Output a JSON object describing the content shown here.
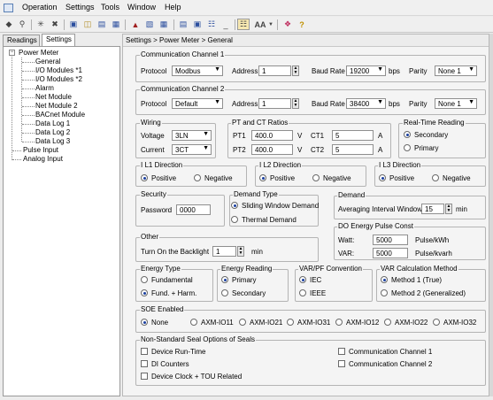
{
  "menu": [
    "Operation",
    "Settings",
    "Tools",
    "Window",
    "Help"
  ],
  "toolbar": [
    "pointer-icon",
    "pin-icon",
    "connect-icon",
    "disconnect-icon",
    "save-icon",
    "open-icon",
    "print-icon",
    "home-icon",
    "chart-icon",
    "layout-icon",
    "grid-icon",
    "list-icon",
    "window-icon",
    "font-icon",
    "book-icon",
    "help-icon"
  ],
  "tabs": {
    "readings": "Readings",
    "settings": "Settings"
  },
  "tree": {
    "power_meter": "Power Meter",
    "general": "General",
    "io1": "I/O Modules *1",
    "io2": "I/O Modules *2",
    "alarm": "Alarm",
    "net1": "Net Module",
    "net2": "Net Module 2",
    "bacnet": "BACnet Module",
    "log1": "Data Log 1",
    "log2": "Data Log 2",
    "log3": "Data Log 3",
    "pulse": "Pulse Input",
    "analog": "Analog Input"
  },
  "breadcrumb": "Settings > Power Meter > General",
  "comm1": {
    "title": "Communication Channel 1",
    "protocol_label": "Protocol",
    "protocol": "Modbus",
    "address_label": "Address",
    "address": "1",
    "baud_label": "Baud Rate",
    "baud": "19200",
    "bps": "bps",
    "parity_label": "Parity",
    "parity": "None 1"
  },
  "comm2": {
    "title": "Communication Channel 2",
    "protocol_label": "Protocol",
    "protocol": "Default",
    "address_label": "Address",
    "address": "1",
    "baud_label": "Baud Rate",
    "baud": "38400",
    "bps": "bps",
    "parity_label": "Parity",
    "parity": "None 1"
  },
  "wiring": {
    "title": "Wiring",
    "voltage_label": "Voltage",
    "voltage": "3LN",
    "current_label": "Current",
    "current": "3CT"
  },
  "ratios": {
    "title": "PT and CT Ratios",
    "pt1_label": "PT1",
    "pt1": "400.0",
    "pt2_label": "PT2",
    "pt2": "400.0",
    "v": "V",
    "ct1_label": "CT1",
    "ct1": "5",
    "ct2_label": "CT2",
    "ct2": "5",
    "a": "A"
  },
  "realtime": {
    "title": "Real-Time Reading",
    "secondary": "Secondary",
    "primary": "Primary"
  },
  "l1": {
    "title": "I L1 Direction",
    "pos": "Positive",
    "neg": "Negative"
  },
  "l2": {
    "title": "I L2 Direction",
    "pos": "Positive",
    "neg": "Negative"
  },
  "l3": {
    "title": "I L3 Direction",
    "pos": "Positive",
    "neg": "Negative"
  },
  "security": {
    "title": "Security",
    "password_label": "Password",
    "password": "0000"
  },
  "demand_type": {
    "title": "Demand Type",
    "sliding": "Sliding Window Demand",
    "thermal": "Thermal Demand"
  },
  "demand": {
    "title": "Demand",
    "interval_label": "Averaging Interval Window",
    "interval": "15",
    "unit": "min"
  },
  "other": {
    "title": "Other",
    "backlight_label": "Turn On the Backlight",
    "backlight": "1",
    "unit": "min"
  },
  "pulse_const": {
    "title": "DO Energy Pulse Const",
    "watt_label": "Watt:",
    "watt": "5000",
    "watt_unit": "Pulse/kWh",
    "var_label": "VAR:",
    "var": "5000",
    "var_unit": "Pulse/kvarh"
  },
  "energy_type": {
    "title": "Energy Type",
    "fund": "Fundamental",
    "fund_harm": "Fund. + Harm."
  },
  "energy_reading": {
    "title": "Energy Reading",
    "primary": "Primary",
    "secondary": "Secondary"
  },
  "varpf": {
    "title": "VAR/PF Convention",
    "iec": "IEC",
    "ieee": "IEEE"
  },
  "varcalc": {
    "title": "VAR Calculation Method",
    "m1": "Method 1 (True)",
    "m2": "Method 2 (Generalized)"
  },
  "soe": {
    "title": "SOE Enabled",
    "options": [
      "None",
      "AXM-IO11",
      "AXM-IO21",
      "AXM-IO31",
      "AXM-IO12",
      "AXM-IO22",
      "AXM-IO32"
    ]
  },
  "seal": {
    "title": "Non-Standard Seal Options of Seals",
    "run": "Device Run-Time",
    "di": "DI Counters",
    "clock": "Device Clock + TOU Related",
    "cc1": "Communication Channel 1",
    "cc2": "Communication Channel 2"
  }
}
